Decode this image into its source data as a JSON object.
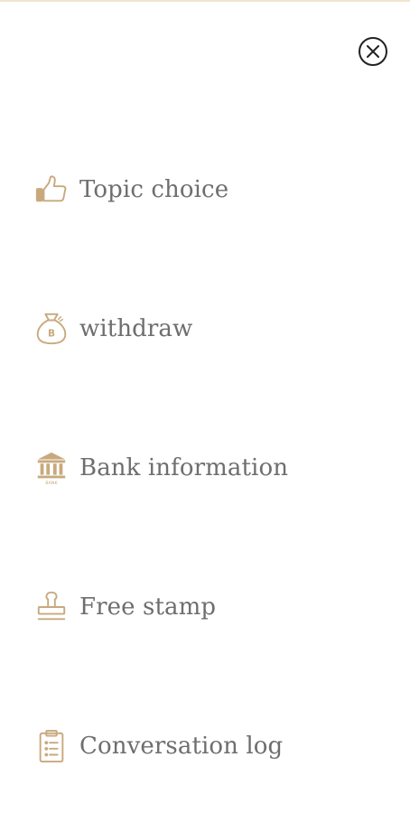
{
  "colors": {
    "accent": "#c8a97e",
    "label": "#6e6e6e",
    "close": "#222222"
  },
  "close_button": {
    "icon": "close-icon"
  },
  "menu": {
    "items": [
      {
        "label": "Topic choice",
        "icon": "thumbs-up-icon"
      },
      {
        "label": "withdraw",
        "icon": "money-bag-icon"
      },
      {
        "label": "Bank information",
        "icon": "bank-icon"
      },
      {
        "label": "Free stamp",
        "icon": "stamp-icon"
      },
      {
        "label": "Conversation log",
        "icon": "clipboard-list-icon"
      }
    ]
  }
}
